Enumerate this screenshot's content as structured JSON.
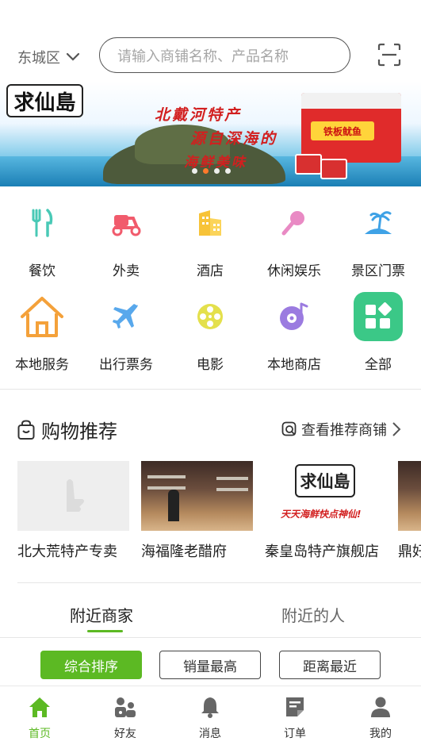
{
  "header": {
    "city": "东城区",
    "search_placeholder": "请输入商铺名称、产品名称"
  },
  "banner": {
    "logo_text": "求仙島",
    "slogan_lines": [
      "北戴河特产",
      "源自深海的",
      "海鲜美味"
    ],
    "product_label": "铁板鱿鱼",
    "slide_count": 4,
    "active_slide": 2
  },
  "categories": [
    {
      "label": "餐饮",
      "icon": "utensils-icon"
    },
    {
      "label": "外卖",
      "icon": "scooter-icon"
    },
    {
      "label": "酒店",
      "icon": "hotel-icon"
    },
    {
      "label": "休闲娱乐",
      "icon": "microphone-icon"
    },
    {
      "label": "景区门票",
      "icon": "island-icon"
    },
    {
      "label": "本地服务",
      "icon": "house-icon"
    },
    {
      "label": "出行票务",
      "icon": "airplane-icon"
    },
    {
      "label": "电影",
      "icon": "film-reel-icon"
    },
    {
      "label": "本地商店",
      "icon": "record-icon"
    },
    {
      "label": "全部",
      "icon": "grid-all-icon"
    }
  ],
  "recommend": {
    "title": "购物推荐",
    "more_label": "查看推荐商铺",
    "shops": [
      {
        "name": "北大荒特产专卖"
      },
      {
        "name": "海福隆老醋府"
      },
      {
        "name": "秦皇岛特产旗舰店",
        "logo_text": "求仙島",
        "slogan": "天天海鲜快点神仙!"
      },
      {
        "name": "鼎好"
      }
    ]
  },
  "tabs": [
    {
      "label": "附近商家",
      "active": true
    },
    {
      "label": "附近的人",
      "active": false
    }
  ],
  "filters": [
    {
      "label": "综合排序",
      "active": true
    },
    {
      "label": "销量最高",
      "active": false
    },
    {
      "label": "距离最近",
      "active": false
    }
  ],
  "bottom_nav": [
    {
      "label": "首页",
      "icon": "home-icon",
      "active": true
    },
    {
      "label": "好友",
      "icon": "friends-icon",
      "active": false
    },
    {
      "label": "消息",
      "icon": "bell-icon",
      "active": false
    },
    {
      "label": "订单",
      "icon": "order-icon",
      "active": false
    },
    {
      "label": "我的",
      "icon": "user-icon",
      "active": false
    }
  ],
  "colors": {
    "accent_green": "#5cb923",
    "slide_active": "#ff7a2b",
    "text_primary": "#222222",
    "text_muted": "#a6a6a6"
  }
}
